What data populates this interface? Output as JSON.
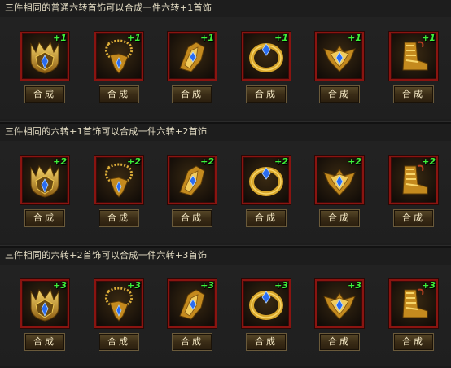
{
  "sections": [
    {
      "title": "三件相同的普通六转首饰可以合成一件六转+1首饰",
      "items": [
        {
          "icon": "helmet-icon",
          "plus": "+1",
          "button": "合成"
        },
        {
          "icon": "necklace-icon",
          "plus": "+1",
          "button": "合成"
        },
        {
          "icon": "bracelet-icon",
          "plus": "+1",
          "button": "合成"
        },
        {
          "icon": "ring-icon",
          "plus": "+1",
          "button": "合成"
        },
        {
          "icon": "belt-icon",
          "plus": "+1",
          "button": "合成"
        },
        {
          "icon": "boots-icon",
          "plus": "+1",
          "button": "合成"
        }
      ]
    },
    {
      "title": "三件相同的六转+1首饰可以合成一件六转+2首饰",
      "items": [
        {
          "icon": "helmet-icon",
          "plus": "+2",
          "button": "合成"
        },
        {
          "icon": "necklace-icon",
          "plus": "+2",
          "button": "合成"
        },
        {
          "icon": "bracelet-icon",
          "plus": "+2",
          "button": "合成"
        },
        {
          "icon": "ring-icon",
          "plus": "+2",
          "button": "合成"
        },
        {
          "icon": "belt-icon",
          "plus": "+2",
          "button": "合成"
        },
        {
          "icon": "boots-icon",
          "plus": "+2",
          "button": "合成"
        }
      ]
    },
    {
      "title": "三件相同的六转+2首饰可以合成一件六转+3首饰",
      "items": [
        {
          "icon": "helmet-icon",
          "plus": "+3",
          "button": "合成"
        },
        {
          "icon": "necklace-icon",
          "plus": "+3",
          "button": "合成"
        },
        {
          "icon": "bracelet-icon",
          "plus": "+3",
          "button": "合成"
        },
        {
          "icon": "ring-icon",
          "plus": "+3",
          "button": "合成"
        },
        {
          "icon": "belt-icon",
          "plus": "+3",
          "button": "合成"
        },
        {
          "icon": "boots-icon",
          "plus": "+3",
          "button": "合成"
        }
      ]
    }
  ],
  "colors": {
    "frame_border": "#8a1410",
    "plus_text": "#3ef23a",
    "title_text": "#e6dfc6",
    "gold": "#d9a72c",
    "gem": "#2a6cf0"
  }
}
